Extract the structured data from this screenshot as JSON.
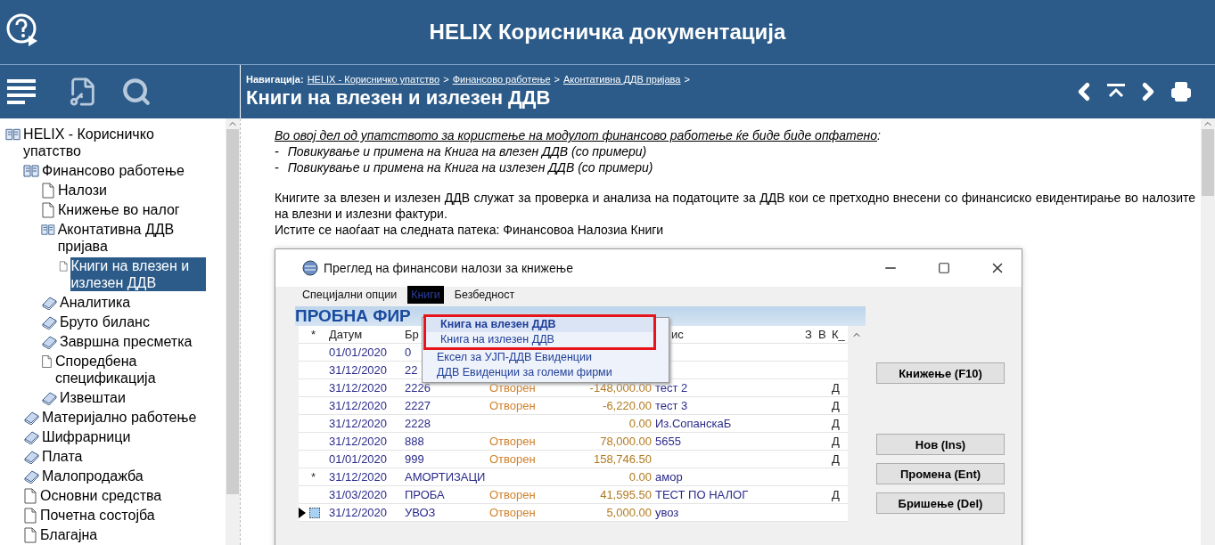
{
  "header": {
    "title": "HELIX Корисничка документација"
  },
  "breadcrumb": {
    "label": "Навигација:",
    "links": [
      "HELIX - Корисничко упатство",
      "Финансово работење",
      "Аконтативна ДДВ пријава"
    ],
    "separator": ">"
  },
  "page_title": "Книги на влезен и излезен ДДВ",
  "sidebar": {
    "items": [
      {
        "label": "HELIX - Корисничко упатство",
        "kind": "open-book",
        "selected": false,
        "children": [
          {
            "label": "Финансово работење",
            "kind": "open-book",
            "selected": false,
            "children": [
              {
                "label": "Налози",
                "kind": "page",
                "selected": false
              },
              {
                "label": "Книжење во налог",
                "kind": "page",
                "selected": false
              },
              {
                "label": "Аконтативна ДДВ пријава",
                "kind": "open-book",
                "selected": false,
                "children": [
                  {
                    "label": "Книги на влезен и излезен ДДВ",
                    "kind": "page",
                    "selected": true
                  }
                ]
              },
              {
                "label": "Аналитика",
                "kind": "closed-book",
                "selected": false
              },
              {
                "label": "Бруто биланс",
                "kind": "closed-book",
                "selected": false
              },
              {
                "label": "Завршна пресметка",
                "kind": "closed-book",
                "selected": false
              },
              {
                "label": "Споредбена спецификација",
                "kind": "page",
                "selected": false
              },
              {
                "label": "Извештаи",
                "kind": "closed-book",
                "selected": false
              }
            ]
          },
          {
            "label": "Материјално работење",
            "kind": "closed-book",
            "selected": false
          },
          {
            "label": "Шифрарници",
            "kind": "closed-book",
            "selected": false
          },
          {
            "label": "Плата",
            "kind": "closed-book",
            "selected": false
          },
          {
            "label": "Малопродажба",
            "kind": "closed-book",
            "selected": false
          },
          {
            "label": "Основни средства",
            "kind": "page",
            "selected": false
          },
          {
            "label": "Почетна состојба",
            "kind": "page",
            "selected": false
          },
          {
            "label": "Благајна",
            "kind": "page",
            "selected": false
          }
        ]
      }
    ]
  },
  "content": {
    "intro": "Во овој дел од упатството за користење на модулот финансово работење ќе биде биде опфатено",
    "intro_colon": ":",
    "bullets": [
      "Повикување и примена на Книга на влезен ДДВ (со примери)",
      "Повикување и примена на Книга на излезен ДДВ (со примери)"
    ],
    "bullet_mark": "-",
    "paragraph": "Книгите за влезен и излезен ДДВ служат за проверка и анализа на податоците за ДДВ кои се претходно внесени со финансиско евидентирање во налозите на влезни и излезни фактури.",
    "path_line": "Истите се наоѓаат на следната патека: Финансовоа Налозиа Книги"
  },
  "app_window": {
    "title": "Преглед на финансови налози за книжење",
    "menu": [
      {
        "label": "Специјални опции",
        "selected": false
      },
      {
        "label": "Книги",
        "selected": true
      },
      {
        "label": "Безбедност",
        "selected": false
      }
    ],
    "company": "ПРОБНА ФИР",
    "dropdown": [
      {
        "label": "Книга на влезен ДДВ",
        "selected": true
      },
      {
        "label": "Книга на излезен ДДВ",
        "selected": false
      },
      {
        "label": "Ексел за УЈП-ДДВ Евиденции",
        "selected": false
      },
      {
        "label": "ДДВ Евиденции за големи фирми",
        "selected": false
      }
    ],
    "columns": [
      "*",
      "Датум",
      "Бр",
      "ис",
      "З",
      "В",
      "К_"
    ],
    "rows": [
      {
        "date": "01/01/2020",
        "number": "0",
        "selected": false
      },
      {
        "date": "31/12/2020",
        "number": "22",
        "selected": false
      },
      {
        "date": "31/12/2020",
        "number": "2226",
        "status": "Отворен",
        "amount": "-148,000.00",
        "description": "тест 2",
        "k": "Д",
        "selected": false
      },
      {
        "date": "31/12/2020",
        "number": "2227",
        "status": "Отворен",
        "amount": "-6,220.00",
        "description": "тест 3",
        "k": "Д",
        "selected": false
      },
      {
        "date": "31/12/2020",
        "number": "2228",
        "amount": "0.00",
        "description": "Из.СопанскаБ",
        "k": "Д",
        "selected": false
      },
      {
        "date": "31/12/2020",
        "number": "888",
        "status": "Отворен",
        "amount": "78,000.00",
        "description": "5655",
        "k": "Д",
        "selected": false
      },
      {
        "date": "01/01/2020",
        "number": "999",
        "status": "Отворен",
        "amount": "158,746.50",
        "k": "Д",
        "selected": false
      },
      {
        "star": "*",
        "date": "31/12/2020",
        "number": "АМОРТИЗАЦИ",
        "amount": "0.00",
        "description": "амор",
        "selected": false
      },
      {
        "date": "31/03/2020",
        "number": "ПРОБА",
        "status": "Отворен",
        "amount": "41,595.50",
        "description": "ТЕСТ ПО НАЛОГ",
        "k": "Д",
        "selected": false
      },
      {
        "date": "31/12/2020",
        "number": "УВОЗ",
        "status": "Отворен",
        "amount": "5,000.00",
        "description": "увоз",
        "selected": true
      }
    ],
    "buttons": [
      "Книжење (F10)",
      "Нов (Ins)",
      "Промена (Ent)",
      "Бришење (Del)"
    ]
  }
}
